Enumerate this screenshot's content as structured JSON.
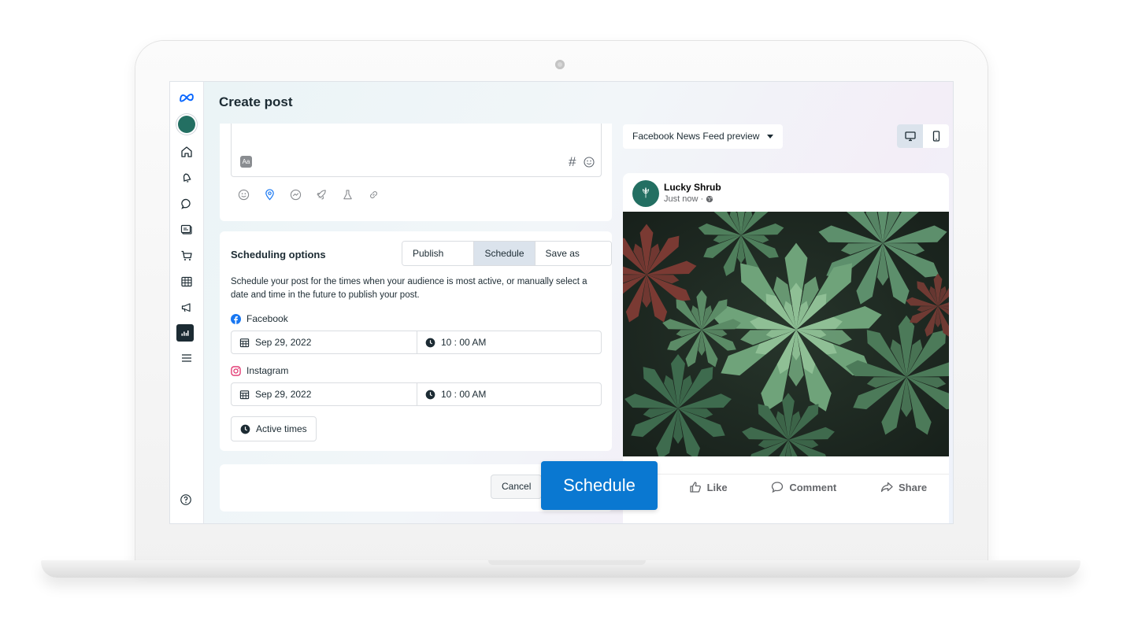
{
  "header": {
    "title": "Create post"
  },
  "composer": {
    "hashtag_symbol": "#"
  },
  "scheduling": {
    "title": "Scheduling options",
    "tabs": [
      {
        "label": "Publish now",
        "selected": false
      },
      {
        "label": "Schedule",
        "selected": true
      },
      {
        "label": "Save as draft",
        "selected": false
      }
    ],
    "description": "Schedule your post for the times when your audience is most active, or manually select a date and time in the future to publish your post.",
    "facebook": {
      "label": "Facebook",
      "date": "Sep 29, 2022",
      "time": "10 : 00 AM"
    },
    "instagram": {
      "label": "Instagram",
      "date": "Sep 29, 2022",
      "time": "10 : 00 AM"
    },
    "active_times_label": "Active times"
  },
  "footer": {
    "cancel_label": "Cancel",
    "schedule_label": "Schedule"
  },
  "preview": {
    "select_label": "Facebook News Feed preview",
    "device_selected": "desktop",
    "page_name": "Lucky Shrub",
    "post_time": "Just now ·",
    "actions": {
      "like": "Like",
      "comment": "Comment",
      "share": "Share"
    }
  },
  "colors": {
    "primary_button": "#0a78d1",
    "brand_avatar": "#236f62",
    "meta_blue": "#0866ff",
    "instagram": "#e1306c",
    "facebook": "#1877f2"
  }
}
